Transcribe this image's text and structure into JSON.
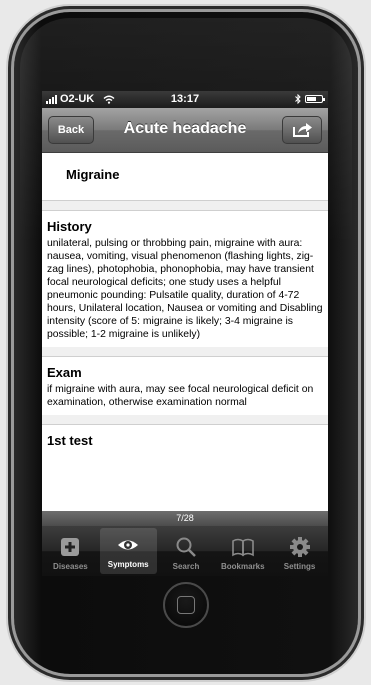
{
  "status": {
    "carrier": "O2-UK",
    "time": "13:17",
    "battery_level": 0.65
  },
  "nav": {
    "back_label": "Back",
    "title": "Acute headache"
  },
  "page_title": "Migraine",
  "sections": {
    "history": {
      "heading": "History",
      "text": "unilateral, pulsing or throbbing pain, migraine with aura: nausea, vomiting, visual phenomenon (flashing lights, zig-zag lines), photophobia, phonophobia, may have transient focal neurological deficits; one study uses a helpful pneumonic pounding: Pulsatile quality, duration of 4-72 hours, Unilateral location, Nausea or vomiting and Disabling intensity (score of 5: migraine is likely; 3-4 migraine is possible; 1-2 migraine is unlikely)"
    },
    "exam": {
      "heading": "Exam",
      "text": "if migraine with aura, may see focal neurological deficit on examination, otherwise examination normal"
    },
    "first_test": {
      "heading": "1st test"
    }
  },
  "pager": "7/28",
  "tabs": [
    {
      "label": "Diseases",
      "icon": "plus-square-icon"
    },
    {
      "label": "Symptoms",
      "icon": "eye-icon"
    },
    {
      "label": "Search",
      "icon": "magnifier-icon"
    },
    {
      "label": "Bookmarks",
      "icon": "book-icon"
    },
    {
      "label": "Settings",
      "icon": "gear-icon"
    }
  ],
  "active_tab": "Symptoms"
}
